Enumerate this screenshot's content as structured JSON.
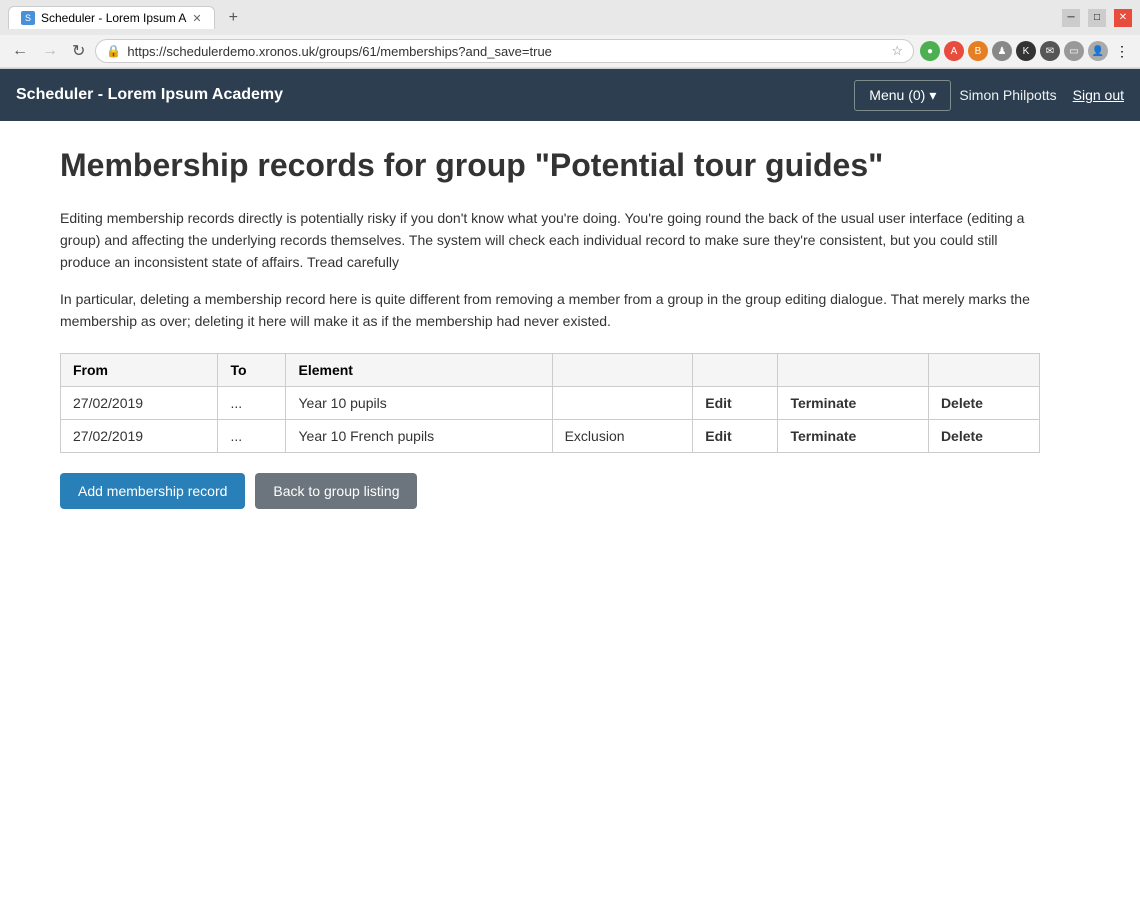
{
  "browser": {
    "tab_title": "Scheduler - Lorem Ipsum A",
    "url": "https://schedulerdemo.xronos.uk/groups/61/memberships?and_save=true",
    "favicon_text": "S"
  },
  "header": {
    "app_title": "Scheduler - Lorem Ipsum Academy",
    "menu_label": "Menu (0)",
    "user_name": "Simon Philpotts",
    "sign_out_label": "Sign out"
  },
  "page": {
    "heading": "Membership records for group \"Potential tour guides\"",
    "warning1": "Editing membership records directly is potentially risky if you don't know what you're doing. You're going round the back of the usual user interface (editing a group) and affecting the underlying records themselves. The system will check each individual record to make sure they're consistent, but you could still produce an inconsistent state of affairs. Tread carefully",
    "warning2": "In particular, deleting a membership record here is quite different from removing a member from a group in the group editing dialogue. That merely marks the membership as over; deleting it here will make it as if the membership had never existed."
  },
  "table": {
    "columns": [
      "From",
      "To",
      "Element",
      "",
      "",
      ""
    ],
    "rows": [
      {
        "from": "27/02/2019",
        "to": "...",
        "element": "Year 10 pupils",
        "extra": "",
        "edit": "Edit",
        "terminate": "Terminate",
        "delete": "Delete"
      },
      {
        "from": "27/02/2019",
        "to": "...",
        "element": "Year 10 French pupils",
        "extra": "Exclusion",
        "edit": "Edit",
        "terminate": "Terminate",
        "delete": "Delete"
      }
    ]
  },
  "buttons": {
    "add_membership": "Add membership record",
    "back_to_group": "Back to group listing"
  }
}
